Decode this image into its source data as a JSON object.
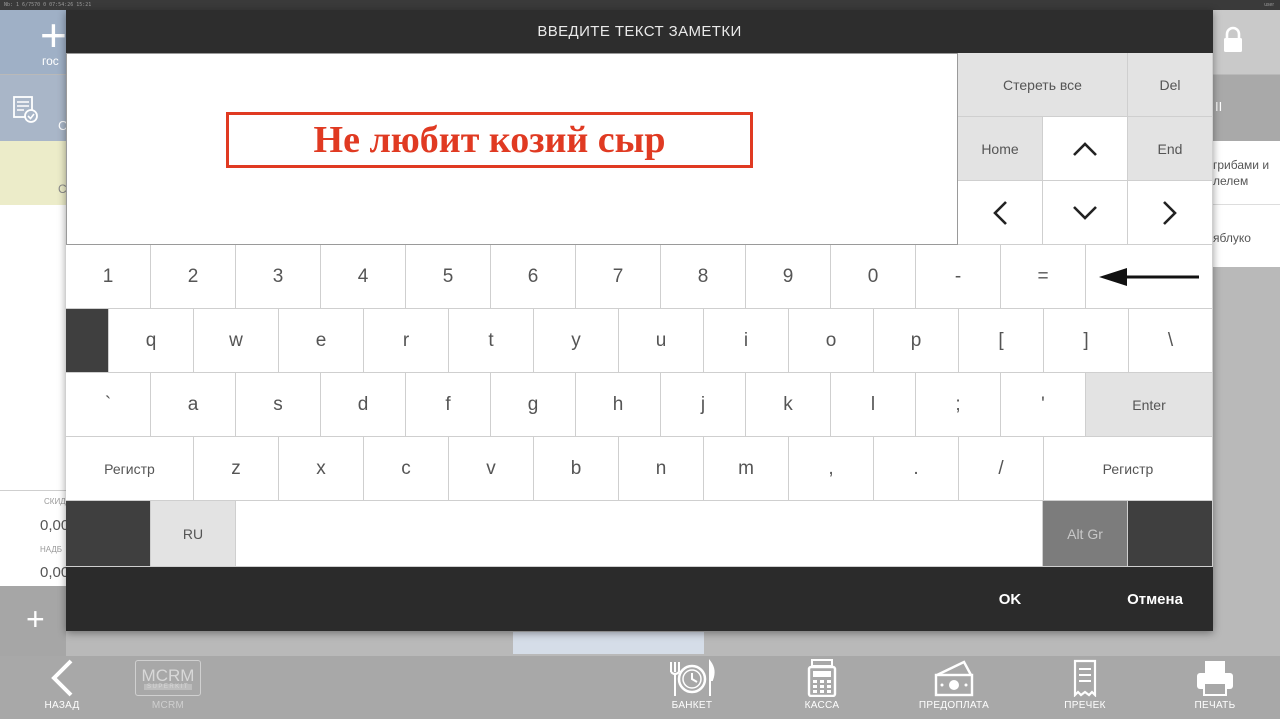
{
  "background": {
    "topbar_text": "Nb: 1 6/7570 0     07:54:26  15:21",
    "user_text": "user",
    "guests_label": "гос",
    "order_status_label": "С",
    "yellow_item_label": "С",
    "discount_label": "СКИД",
    "discount_value": "0,00",
    "markup_label": "НАДБ",
    "markup_value": "0,00",
    "right_mid_label": "II",
    "right_item1": [
      "грибами и",
      "лелем"
    ],
    "right_item2": "яблуко"
  },
  "toolbar": {
    "back": "НАЗАД",
    "mcrm": "MCRM",
    "mcrm_logo_top": "MCRM",
    "mcrm_logo_bottom": "SUPERKIT",
    "banquet": "БАНКЕТ",
    "cashbox": "КАССА",
    "prepay": "ПРЕДОПЛАТА",
    "precheck": "ПРЕЧЕК",
    "print": "ПЕЧАТЬ"
  },
  "dialog": {
    "title": "ВВЕДИТЕ ТЕКСТ ЗАМЕТКИ",
    "note_text": "Не любит козий сыр",
    "nav": {
      "clear_all": "Стереть все",
      "del": "Del",
      "home": "Home",
      "end": "End"
    },
    "keyboard": {
      "row_numbers": [
        "1",
        "2",
        "3",
        "4",
        "5",
        "6",
        "7",
        "8",
        "9",
        "0",
        "-",
        "="
      ],
      "row_q": [
        "q",
        "w",
        "e",
        "r",
        "t",
        "y",
        "u",
        "i",
        "o",
        "p",
        "[",
        "]",
        "\\"
      ],
      "row_a": [
        "`",
        "a",
        "s",
        "d",
        "f",
        "g",
        "h",
        "j",
        "k",
        "l",
        ";",
        "'"
      ],
      "enter": "Enter",
      "shift": "Регистр",
      "row_z": [
        "z",
        "x",
        "c",
        "v",
        "b",
        "n",
        "m",
        ",",
        ".",
        "/"
      ],
      "lang": "RU",
      "altgr": "Alt Gr"
    },
    "ok": "OK",
    "cancel": "Отмена"
  }
}
